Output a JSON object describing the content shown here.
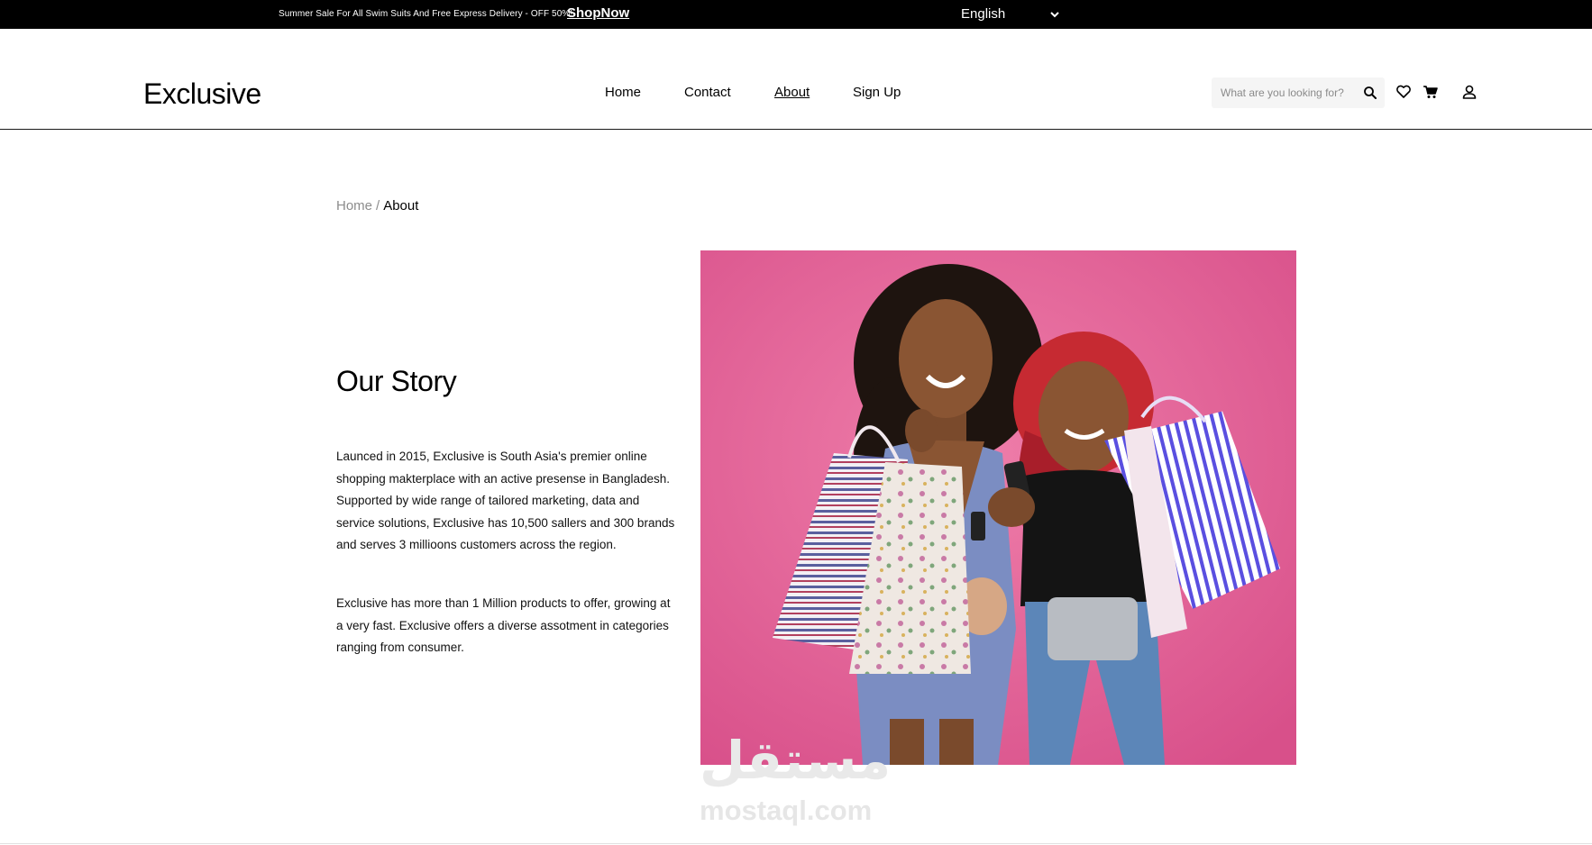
{
  "topbar": {
    "promo_text": "Summer Sale For All Swim Suits And Free Express Delivery - OFF 50%!",
    "shop_now": "ShopNow",
    "language": "English",
    "language_icon": "chevron-down-icon"
  },
  "header": {
    "logo": "Exclusive",
    "nav": [
      {
        "label": "Home",
        "active": false
      },
      {
        "label": "Contact",
        "active": false
      },
      {
        "label": "About",
        "active": true
      },
      {
        "label": "Sign Up",
        "active": false
      }
    ],
    "search": {
      "placeholder": "What are you looking for?",
      "icon": "search-icon"
    },
    "icons": [
      "heart-icon",
      "cart-icon",
      "user-icon"
    ]
  },
  "breadcrumb": {
    "home": "Home",
    "separator": "/",
    "current": "About"
  },
  "story": {
    "title": "Our Story",
    "paragraph1": "Launced in 2015, Exclusive is South Asia's premier online shopping makterplace with an active presense in Bangladesh. Supported by wide range of tailored marketing, data and service solutions, Exclusive has 10,500 sallers and 300 brands and serves 3 millioons customers across the region.",
    "paragraph2": "Exclusive has more than 1 Million products to offer, growing at a very fast. Exclusive offers a diverse assotment in categories ranging from consumer."
  },
  "watermark": {
    "arabic": "مستقل",
    "latin": "mostaql.com"
  },
  "colors": {
    "accent": "#000000",
    "photo_background": "#e5729f",
    "muted": "#8c8c8c"
  }
}
